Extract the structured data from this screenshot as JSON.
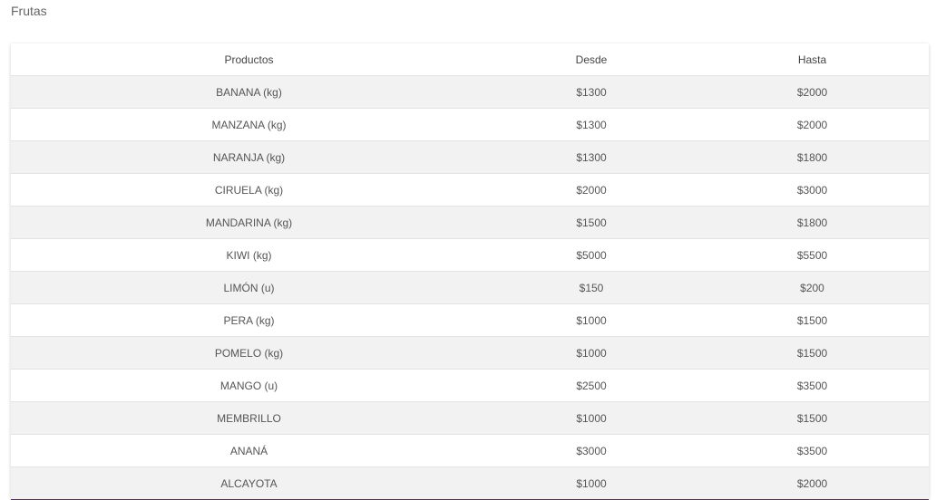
{
  "section": {
    "title": "Frutas"
  },
  "table": {
    "headers": [
      "Productos",
      "Desde",
      "Hasta"
    ],
    "rows": [
      [
        "BANANA (kg)",
        "$1300",
        "$2000"
      ],
      [
        "MANZANA (kg)",
        "$1300",
        "$2000"
      ],
      [
        "NARANJA (kg)",
        "$1300",
        "$1800"
      ],
      [
        "CIRUELA (kg)",
        "$2000",
        "$3000"
      ],
      [
        "MANDARINA (kg)",
        "$1500",
        "$1800"
      ],
      [
        "KIWI (kg)",
        "$5000",
        "$5500"
      ],
      [
        "LIMÓN (u)",
        "$150",
        "$200"
      ],
      [
        "PERA (kg)",
        "$1000",
        "$1500"
      ],
      [
        "POMELO (kg)",
        "$1000",
        "$1500"
      ],
      [
        "MANGO (u)",
        "$2500",
        "$3500"
      ],
      [
        "MEMBRILLO",
        "$1000",
        "$1500"
      ],
      [
        "ANANÁ",
        "$3000",
        "$3500"
      ],
      [
        "ALCAYOTA",
        "$1000",
        "$2000"
      ]
    ]
  },
  "colors": {
    "stripe": "#f2f2f2",
    "accent_border": "#5b2a6e"
  }
}
